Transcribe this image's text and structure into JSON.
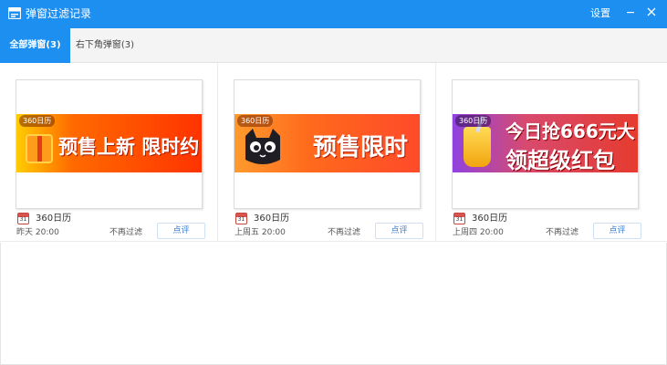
{
  "window": {
    "title": "弹窗过滤记录",
    "settings_label": "设置"
  },
  "tabs": [
    {
      "label": "全部弹窗(3)",
      "active": true
    },
    {
      "label": "右下角弹窗(3)",
      "active": false
    }
  ],
  "cards": [
    {
      "banner_badge": "360日历",
      "banner_headline": "预售上新 限时约",
      "source_icon_text": "31",
      "source_name": "360日历",
      "time": "昨天 20:00",
      "no_filter_label": "不再过滤",
      "rate_label": "点评"
    },
    {
      "banner_badge": "360日历",
      "banner_headline": "预售限时",
      "source_icon_text": "31",
      "source_name": "360日历",
      "time": "上周五 20:00",
      "no_filter_label": "不再过滤",
      "rate_label": "点评"
    },
    {
      "banner_badge": "360日历",
      "banner_headline": "今日抢666元大",
      "banner_headline2": "领超级红包",
      "source_icon_text": "31",
      "source_name": "360日历",
      "time": "上周四 20:00",
      "no_filter_label": "不再过滤",
      "rate_label": "点评"
    }
  ],
  "colors": {
    "accent": "#1d8ff0",
    "title_bar": "#1d8ff0",
    "tab_bar_bg": "#f4f4f4"
  },
  "icons": {
    "app": "window-icon",
    "minimize": "minimize-icon",
    "close": "close-icon",
    "source": "calendar-icon"
  }
}
